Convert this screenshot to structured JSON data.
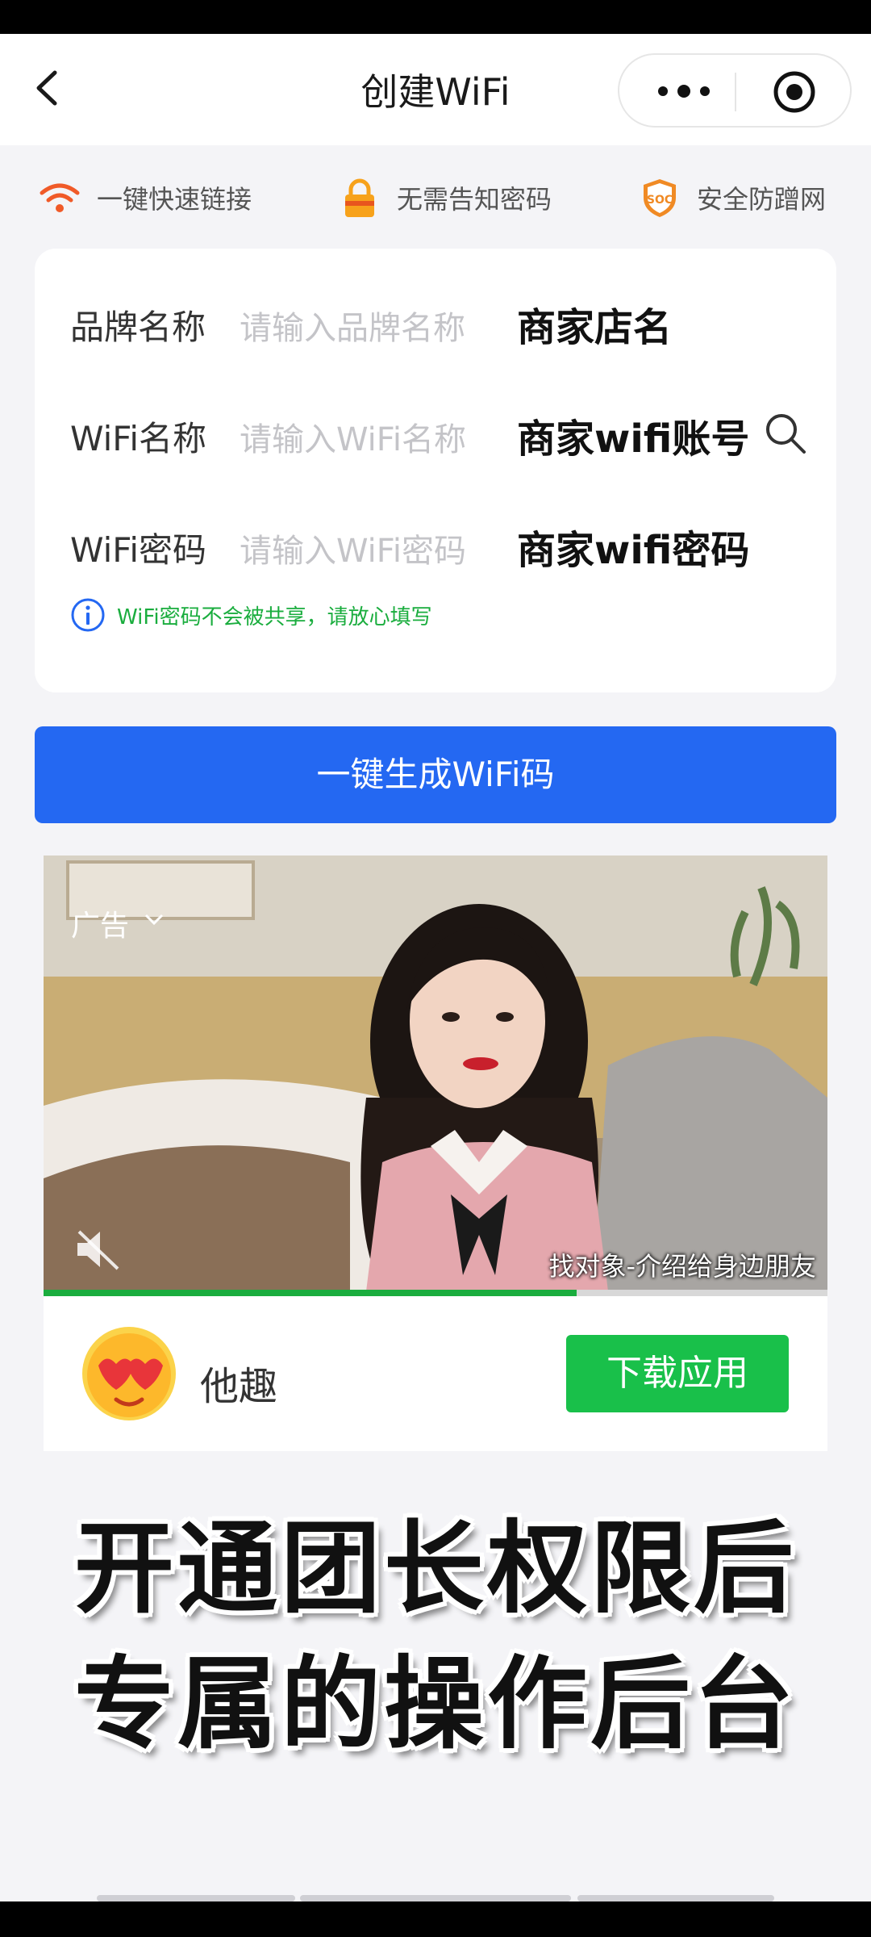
{
  "nav": {
    "title": "创建WiFi",
    "back_icon": "chevron-left-icon",
    "more_icon": "more-dots-icon",
    "target_icon": "target-icon"
  },
  "features": [
    {
      "icon": "wifi-icon",
      "label": "一键快速链接",
      "color": "#f05a28"
    },
    {
      "icon": "lock-icon",
      "label": "无需告知密码",
      "color": "#f7a21b"
    },
    {
      "icon": "soc-shield-icon",
      "label": "安全防蹭网",
      "color": "#f08a24"
    }
  ],
  "form": {
    "rows": [
      {
        "label": "品牌名称",
        "placeholder": "请输入品牌名称",
        "overlay": "商家店名"
      },
      {
        "label": "WiFi名称",
        "placeholder": "请输入WiFi名称",
        "overlay": "商家wifi账号"
      },
      {
        "label": "WiFi密码",
        "placeholder": "请输入WiFi密码",
        "overlay": "商家wifi密码"
      }
    ],
    "hint": "WiFi密码不会被共享，请放心填写"
  },
  "generate_button": "一键生成WiFi码",
  "ad": {
    "tag": "广告",
    "caption": "找对象-介绍给身边朋友",
    "progress": 0.68,
    "app_name": "他趣",
    "download_label": "下载应用"
  },
  "overlay_text": {
    "line1": "开通团长权限后",
    "line2": "专属的操作后台"
  },
  "colors": {
    "primary_blue": "#2468f2",
    "green": "#1aad3e",
    "download_green": "#19c04a"
  }
}
